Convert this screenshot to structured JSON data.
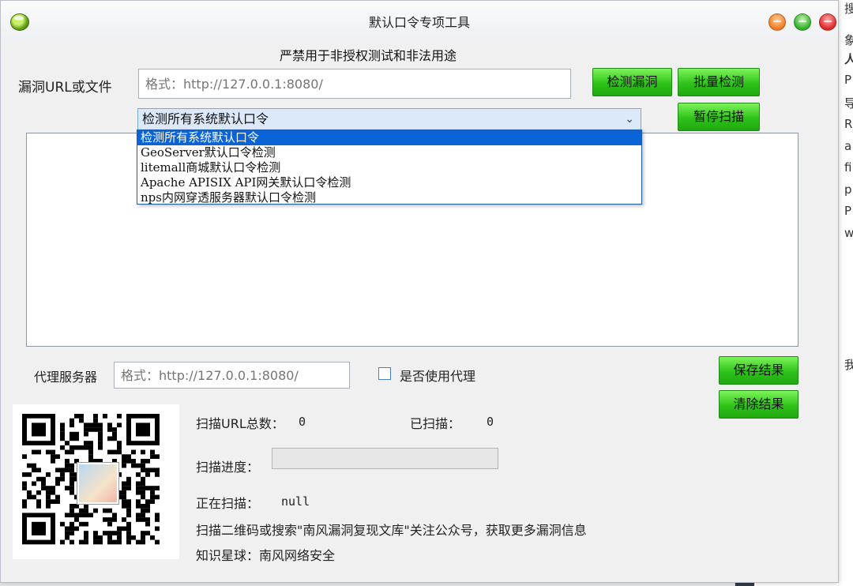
{
  "window": {
    "title": "默认口令专项工具",
    "warning": "严禁用于非授权测试和非法用途"
  },
  "url_section": {
    "label": "漏洞URL或文件",
    "placeholder": "格式：http://127.0.0.1:8080/",
    "detect_button": "检测漏洞",
    "batch_button": "批量检测",
    "pause_button": "暂停扫描"
  },
  "combo": {
    "selected": "检测所有系统默认口令",
    "options": [
      "检测所有系统默认口令",
      "GeoServer默认口令检测",
      "litemall商城默认口令检测",
      "Apache APISIX API网关默认口令检测",
      "nps内网穿透服务器默认口令检测"
    ]
  },
  "proxy": {
    "label": "代理服务器",
    "placeholder": "格式：http://127.0.0.1:8080/",
    "use_proxy_label": "是否使用代理",
    "use_proxy_checked": false
  },
  "actions": {
    "save_button": "保存结果",
    "clear_button": "清除结果"
  },
  "stats": {
    "total_label": "扫描URL总数：",
    "total_value": "0",
    "scanned_label": "已扫描：",
    "scanned_value": "0",
    "progress_label": "扫描进度：",
    "progress_value": 0,
    "current_label": "正在扫描：",
    "current_value": "null",
    "promo": "扫描二维码或搜索\"南风漏洞复现文库\"关注公众号，获取更多漏洞信息",
    "planet": "知识星球：南风网络安全"
  },
  "background_window": {
    "lines": [
      "搜索组件字",
      "象",
      "人",
      "P",
      "导",
      "R",
      "a",
      "fi",
      "p",
      "P",
      "w",
      "我"
    ]
  },
  "colors": {
    "button_green": "#2fc31a",
    "selection_blue": "#0a64d6",
    "combo_bg": "#dce9f8"
  }
}
